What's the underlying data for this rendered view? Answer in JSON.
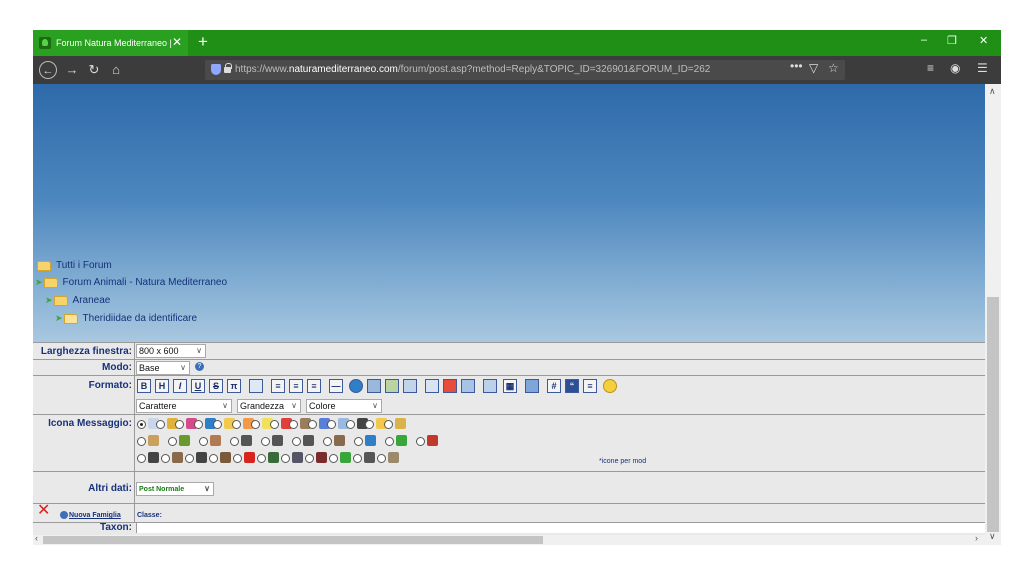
{
  "browser": {
    "tab_title": "Forum Natura Mediterraneo | F",
    "url_prefix": "https://www.",
    "url_domain": "naturamediterraneo.com",
    "url_path": "/forum/post.asp?method=Reply&TOPIC_ID=326901&FORUM_ID=262",
    "page_actions": "•••"
  },
  "breadcrumb": {
    "items": [
      "Tutti i Forum",
      "Forum Animali - Natura Mediterraneo",
      "Araneae",
      "Theridiidae da identificare"
    ]
  },
  "form": {
    "window_width": {
      "label": "Larghezza finestra:",
      "value": "800 x 600"
    },
    "mode": {
      "label": "Modo:",
      "value": "Base"
    },
    "format": {
      "label": "Formato:",
      "buttons": [
        "B",
        "H",
        "I",
        "U",
        "S",
        "π"
      ]
    },
    "font_selects": [
      "Carattere",
      "Grandezza",
      "Colore"
    ],
    "message_icon": {
      "label": "Icona Messaggio:",
      "mod_note": "*icone per mod"
    },
    "other": {
      "label": "Altri dati:",
      "value": "Post Normale"
    },
    "new_family_link": "Nuova Famiglia",
    "class_label": "Classe:",
    "taxon_label": "Taxon:"
  }
}
